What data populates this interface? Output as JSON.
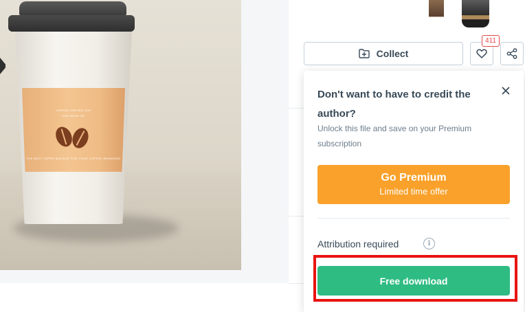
{
  "toolbar": {
    "collect_label": "Collect",
    "like_count": "411"
  },
  "icons": {
    "collect": "folder-plus-icon",
    "like": "heart-icon",
    "share": "share-icon",
    "close": "close-icon",
    "info": "info-icon"
  },
  "preview": {
    "sleeve_title": "COFFEE COFFEE CUP",
    "sleeve_subtitle": "THE MOCK UP",
    "sleeve_body": "THE BEST PAPER MOCKUP FOR YOUR COFFEE BRANDING"
  },
  "popup": {
    "title": "Don't want to have to credit the author?",
    "subtitle": "Unlock this file and save on your Premium subscription",
    "premium_label": "Go Premium",
    "premium_sub": "Limited time offer",
    "attribution_label": "Attribution required",
    "free_download_label": "Free download"
  },
  "colors": {
    "premium": "#f9a12a",
    "free_download": "#2ebc82",
    "highlight": "#e8140f",
    "like_badge": "#e34a4a"
  }
}
